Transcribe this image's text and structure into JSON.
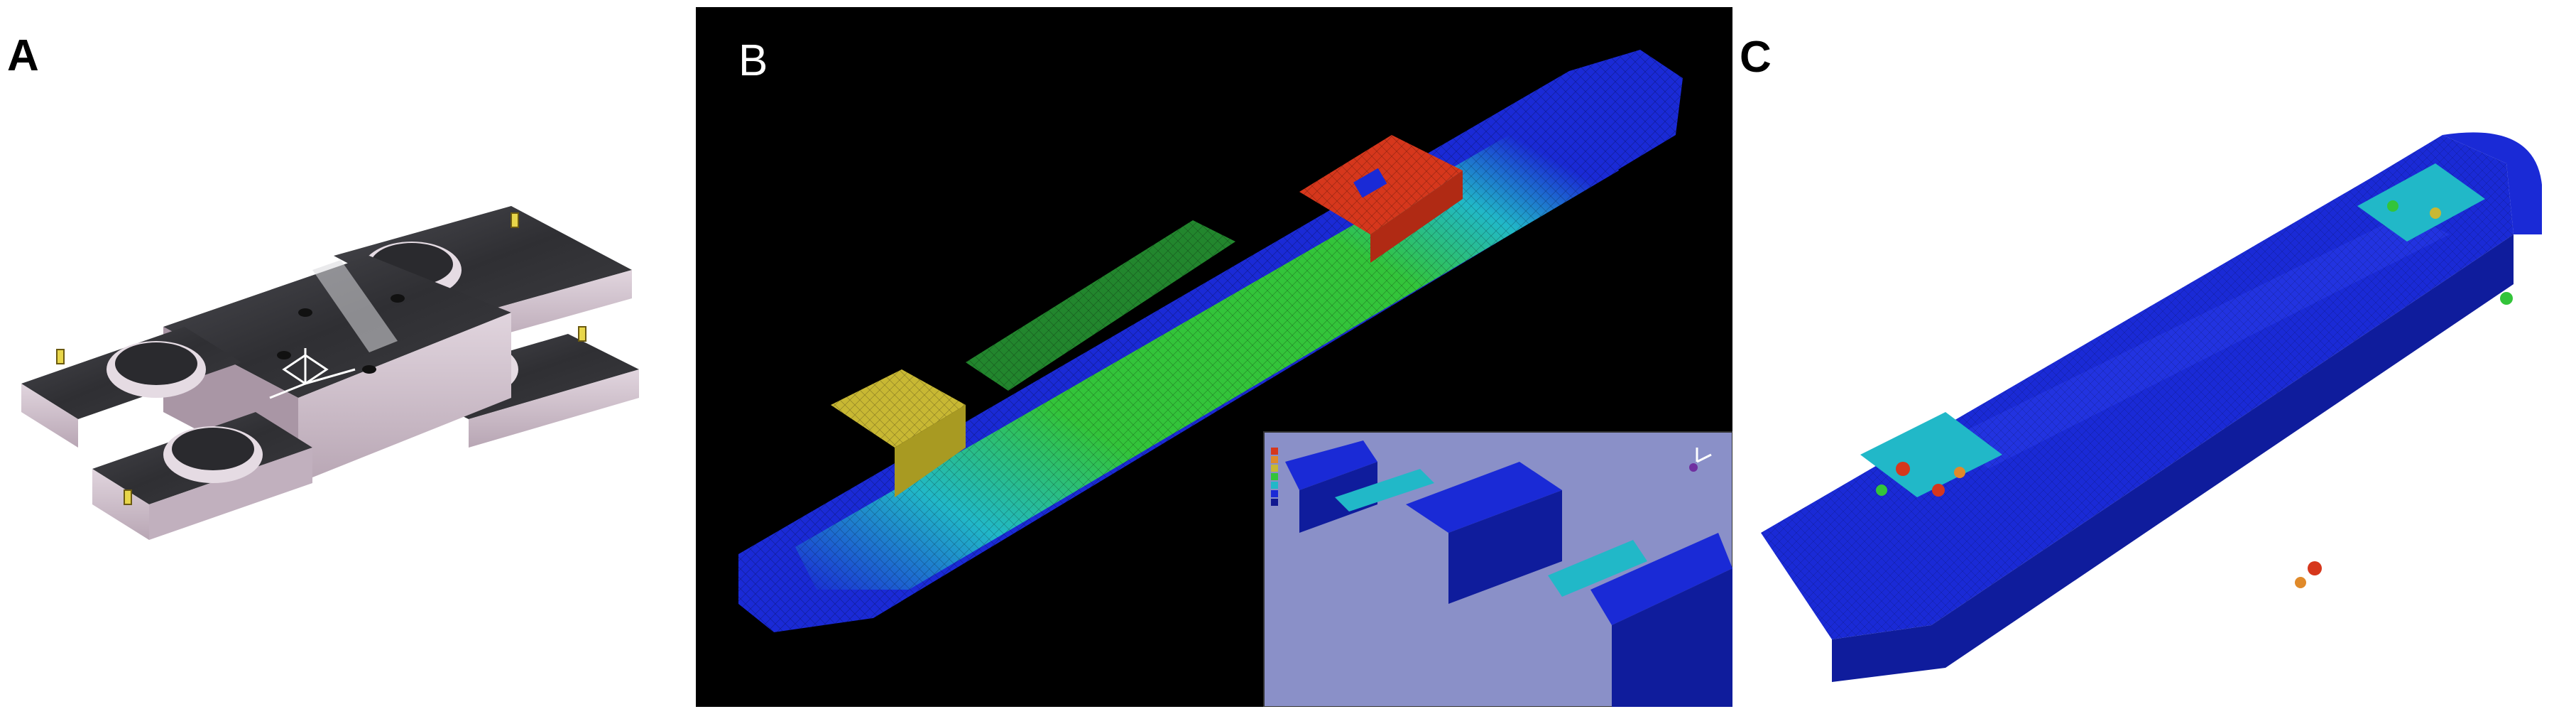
{
  "panels": [
    {
      "id": "A",
      "label": "A",
      "description_icon": "cad-bracket-model"
    },
    {
      "id": "B",
      "label": "B",
      "description_icon": "fem-stress-contour-rail"
    },
    {
      "id": "C",
      "label": "C",
      "description_icon": "fem-stress-contour-plate"
    }
  ],
  "colors": {
    "background": "#ffffff",
    "panel_b_background": "#000000",
    "cad_dark": "#3a3a3e",
    "cad_side": "#c9b9c6",
    "fem_blue": "#1a2ad6",
    "fem_cyan": "#21b8c8",
    "fem_green": "#33c43a",
    "fem_yellow": "#c8b833",
    "fem_red": "#d6371c",
    "inset_bg": "#8a90c8"
  }
}
